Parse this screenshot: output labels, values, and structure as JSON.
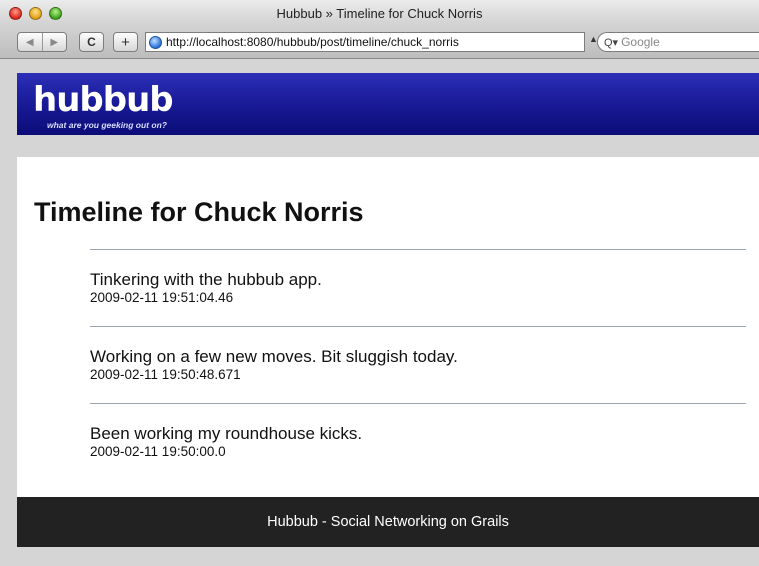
{
  "browser": {
    "window_title": "Hubbub » Timeline for Chuck Norris",
    "back_icon": "back-arrow-icon",
    "forward_icon": "forward-arrow-icon",
    "reload_glyph": "C",
    "add_bookmark_glyph": "+",
    "url": "http://localhost:8080/hubbub/post/timeline/chuck_norris",
    "search_placeholder": "Google"
  },
  "site": {
    "logo": "hubbub",
    "tagline": "what are you geeking out on?"
  },
  "page": {
    "title": "Timeline for Chuck Norris",
    "posts": [
      {
        "content": "Tinkering with the hubbub app.",
        "date": "2009-02-11 19:51:04.46"
      },
      {
        "content": "Working on a few new moves. Bit sluggish today.",
        "date": "2009-02-11 19:50:48.671"
      },
      {
        "content": "Been working my roundhouse kicks.",
        "date": "2009-02-11 19:50:00.0"
      }
    ]
  },
  "footer": {
    "text": "Hubbub - Social Networking on Grails"
  },
  "colors": {
    "header_blue": "#1a1c9a",
    "footer_dark": "#222222",
    "divider": "#9aa3b0"
  }
}
